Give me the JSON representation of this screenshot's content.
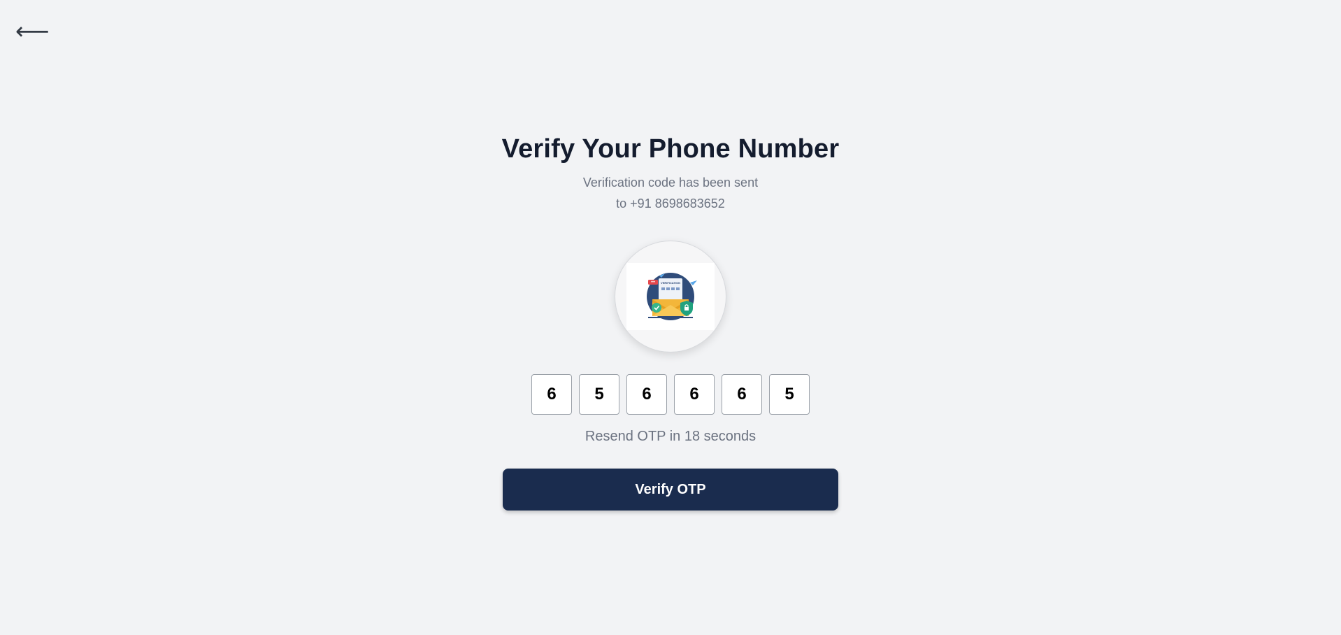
{
  "header": {
    "back_icon": "arrow-left-icon",
    "back_glyph": "⟵"
  },
  "main": {
    "title": "Verify Your Phone Number",
    "subtitle_line1": "Verification code has been sent",
    "subtitle_line2": "to +91 8698683652",
    "illustration_icon": "email-verification-illustration",
    "illustration_text": "VERIFICATION",
    "illustration_badge": "***",
    "otp_digits": [
      "6",
      "5",
      "6",
      "6",
      "6",
      "5"
    ],
    "resend_text": "Resend OTP in 18 seconds",
    "verify_label": "Verify OTP"
  },
  "colors": {
    "background": "#f2f3f5",
    "title": "#141c2e",
    "muted_text": "#6b7280",
    "button": "#1a2c4e",
    "button_text": "#ffffff"
  }
}
